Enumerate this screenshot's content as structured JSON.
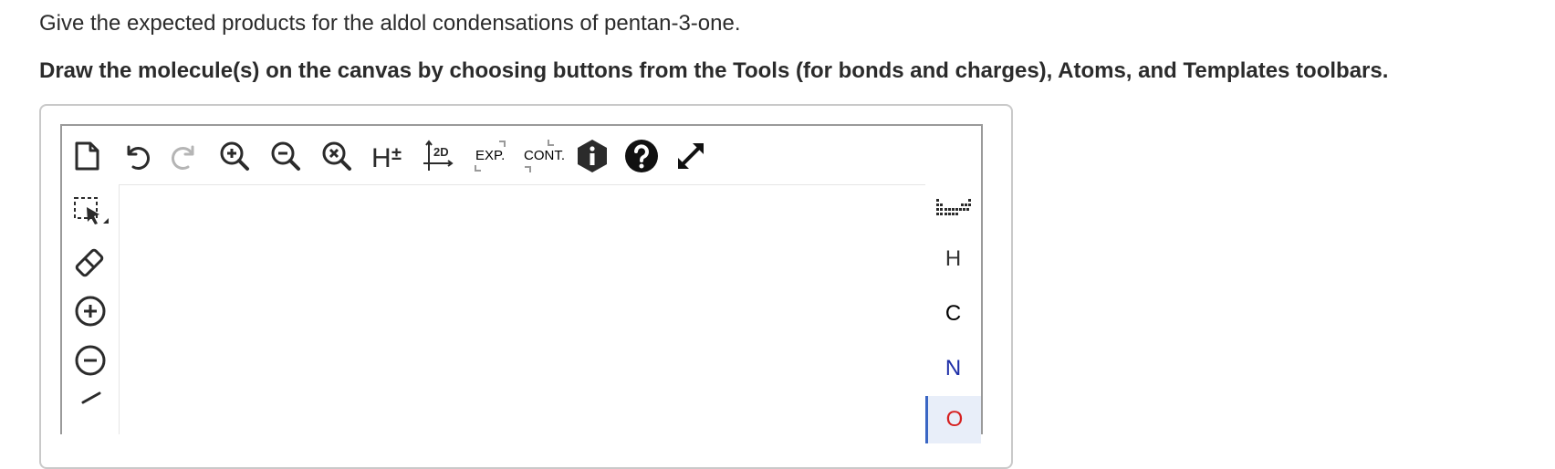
{
  "question": {
    "prompt": "Give the expected products for the aldol condensations of pentan-3-one.",
    "instruction": "Draw the molecule(s) on the canvas by choosing buttons from the Tools (for bonds and charges), Atoms, and Templates toolbars."
  },
  "toolbar": {
    "h_label": "H",
    "h_pm": "±",
    "layout_label": "2D",
    "expand_label": "EXP.",
    "contract_label": "CONT."
  },
  "atoms": [
    {
      "label": "H",
      "color": "#333333"
    },
    {
      "label": "C",
      "color": "#000000"
    },
    {
      "label": "N",
      "color": "#1f2fa8"
    },
    {
      "label": "O",
      "color": "#d62020"
    }
  ],
  "colors": {
    "accent": "#3a66c4",
    "icon": "#2b2b2b",
    "disabled_icon": "#b5b5b5"
  }
}
